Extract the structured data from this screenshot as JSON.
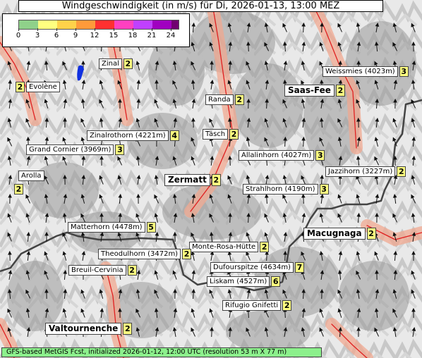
{
  "title": "Windgeschwindigkeit (in m/s) für Di, 2026-01-13, 13:00 MEZ",
  "legend": {
    "ticks": [
      "0",
      "3",
      "6",
      "9",
      "12",
      "15",
      "18",
      "21",
      "24"
    ],
    "colors": [
      "#8fd18a",
      "#ffff80",
      "#ffd24a",
      "#ff9a3a",
      "#ff3030",
      "#ff40c0",
      "#c040ff",
      "#a000c0",
      "#700070"
    ]
  },
  "places": [
    {
      "name": "Zinal",
      "wind": "2",
      "big": false
    },
    {
      "name": "Evolène",
      "wind": "2",
      "big": false,
      "value_first": true
    },
    {
      "name": "Weissmies (4023m)",
      "wind": "3",
      "big": false
    },
    {
      "name": "Saas-Fee",
      "wind": "2",
      "big": true
    },
    {
      "name": "Randa",
      "wind": "2",
      "big": false
    },
    {
      "name": "Zinalrothorn (4221m)",
      "wind": "4",
      "big": false
    },
    {
      "name": "Täsch",
      "wind": "2",
      "big": false
    },
    {
      "name": "Grand Cornier (3969m)",
      "wind": "3",
      "big": false
    },
    {
      "name": "Allalinhorn (4027m)",
      "wind": "3",
      "big": false
    },
    {
      "name": "Jazzihorn (3227m)",
      "wind": "2",
      "big": false
    },
    {
      "name": "Arolla",
      "wind": "2",
      "big": false,
      "stacked": true
    },
    {
      "name": "Zermatt",
      "wind": "2",
      "big": true
    },
    {
      "name": "Strahlhorn (4190m)",
      "wind": "3",
      "big": false
    },
    {
      "name": "Matterhorn (4478m)",
      "wind": "5",
      "big": false
    },
    {
      "name": "Macugnaga",
      "wind": "2",
      "big": true
    },
    {
      "name": "Monte-Rosa-Hütte",
      "wind": "2",
      "big": false
    },
    {
      "name": "Theodulhorn (3472m)",
      "wind": "2",
      "big": false
    },
    {
      "name": "Breuil-Cervinia",
      "wind": "2",
      "big": false
    },
    {
      "name": "Dufourspitze (4634m)",
      "wind": "7",
      "big": false
    },
    {
      "name": "Liskam (4527m)",
      "wind": "6",
      "big": false
    },
    {
      "name": "Rifugio Gnifetti",
      "wind": "2",
      "big": false
    },
    {
      "name": "Valtournenche",
      "wind": "2",
      "big": true
    }
  ],
  "footer": "GFS-based MetGIS Fcst, initialized 2026-01-12, 12:00 UTC  (resolution 53 m X 77 m)"
}
